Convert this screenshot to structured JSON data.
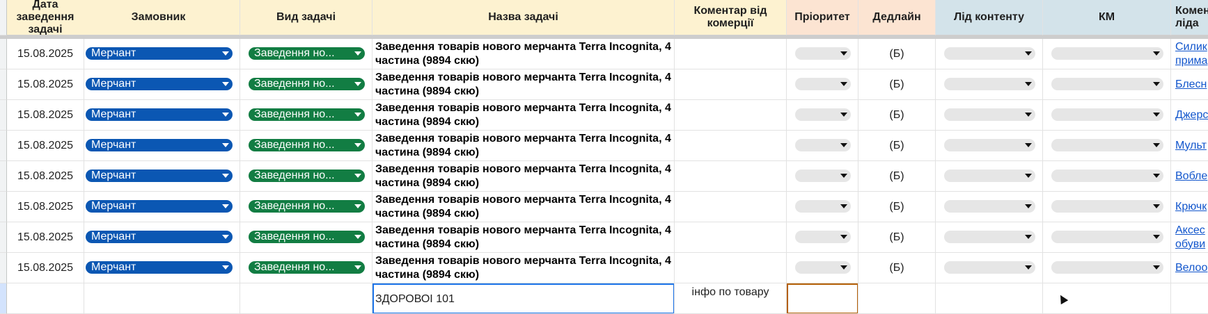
{
  "headers": {
    "date": "Дата заведення задачі",
    "customer": "Замовник",
    "task_type": "Вид задачі",
    "task_name": "Назва задачі",
    "commerce_comment": "Коментар від комерції",
    "priority": "Пріоритет",
    "deadline": "Дедлайн",
    "content_lead": "Лід контенту",
    "km": "КМ",
    "lead_comment": "Коментар ліда"
  },
  "header_colors": {
    "yellow": "#fdf2d0",
    "orange": "#fce4d2",
    "blue": "#d3e3ea"
  },
  "chip_colors": {
    "customer": "#0b57b3",
    "task_type": "#127d43",
    "empty": "#e6e6e6"
  },
  "rows": [
    {
      "date": "15.08.2025",
      "customer": "Мерчант",
      "task_type": "Заведення но...",
      "task_name": "Заведення товарів нового мерчанта Terra Incognita, 4 частина (9894 скю)",
      "deadline": "(Б)",
      "lead_comment": "Силик\nприма"
    },
    {
      "date": "15.08.2025",
      "customer": "Мерчант",
      "task_type": "Заведення но...",
      "task_name": "Заведення товарів нового мерчанта Terra Incognita, 4 частина (9894 скю)",
      "deadline": "(Б)",
      "lead_comment": "Блесн"
    },
    {
      "date": "15.08.2025",
      "customer": "Мерчант",
      "task_type": "Заведення но...",
      "task_name": "Заведення товарів нового мерчанта Terra Incognita, 4 частина (9894 скю)",
      "deadline": "(Б)",
      "lead_comment": "Джерс"
    },
    {
      "date": "15.08.2025",
      "customer": "Мерчант",
      "task_type": "Заведення но...",
      "task_name": "Заведення товарів нового мерчанта Terra Incognita, 4 частина (9894 скю)",
      "deadline": "(Б)",
      "lead_comment": "Мульт"
    },
    {
      "date": "15.08.2025",
      "customer": "Мерчант",
      "task_type": "Заведення но...",
      "task_name": "Заведення товарів нового мерчанта Terra Incognita, 4 частина (9894 скю)",
      "deadline": "(Б)",
      "lead_comment": "Вобле"
    },
    {
      "date": "15.08.2025",
      "customer": "Мерчант",
      "task_type": "Заведення но...",
      "task_name": "Заведення товарів нового мерчанта Terra Incognita, 4 частина (9894 скю)",
      "deadline": "(Б)",
      "lead_comment": "Крючк"
    },
    {
      "date": "15.08.2025",
      "customer": "Мерчант",
      "task_type": "Заведення но...",
      "task_name": "Заведення товарів нового мерчанта Terra Incognita, 4 частина (9894 скю)",
      "deadline": "(Б)",
      "lead_comment": "Аксес\nобуви"
    },
    {
      "date": "15.08.2025",
      "customer": "Мерчант",
      "task_type": "Заведення но...",
      "task_name": "Заведення товарів нового мерчанта Terra Incognita, 4 частина (9894 скю)",
      "deadline": "(Б)",
      "lead_comment": "Велоо"
    }
  ],
  "last_row": {
    "task_name": "ЗДОРОВОІ 101",
    "commerce_comment": "інфо по товару"
  }
}
